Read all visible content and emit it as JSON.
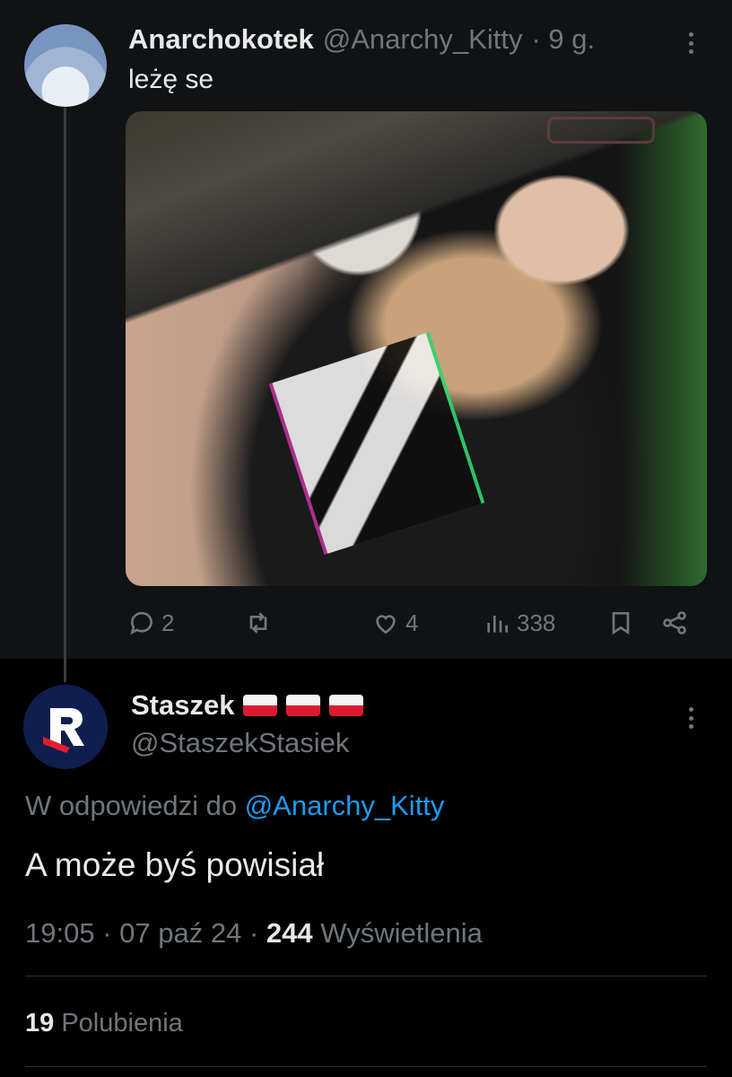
{
  "parent_tweet": {
    "display_name": "Anarchokotek",
    "handle": "@Anarchy_Kitty",
    "separator": "·",
    "time": "9 g.",
    "text": "leżę se",
    "actions": {
      "replies": "2",
      "reposts": "",
      "likes": "4",
      "views": "338"
    }
  },
  "reply_tweet": {
    "display_name": "Staszek",
    "handle": "@StaszekStasiek",
    "reply_prefix": "W odpowiedzi do",
    "reply_mention": "@Anarchy_Kitty",
    "text": "A może byś powisiał",
    "time": "19:05",
    "date": "07 paź 24",
    "views_count": "244",
    "views_label": "Wyświetlenia",
    "likes_count": "19",
    "likes_label": "Polubienia"
  },
  "icons": {
    "reply": "comment-icon",
    "repost": "repost-icon",
    "like": "heart-icon",
    "views": "bar-chart-icon",
    "bookmark": "bookmark-icon",
    "share": "share-icon",
    "more": "more-vertical-icon"
  },
  "colors": {
    "accent": "#1d9bf0",
    "muted": "#71767b",
    "flag_white": "#f4f4f4",
    "flag_red": "#dc1b33"
  }
}
